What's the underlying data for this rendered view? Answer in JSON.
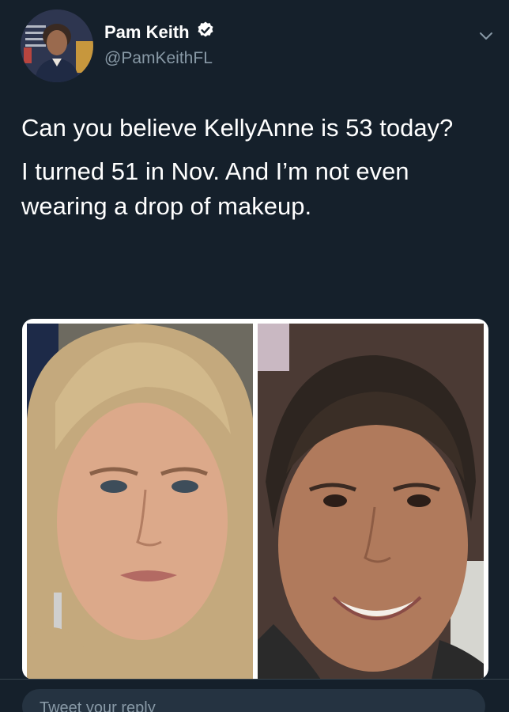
{
  "tweet": {
    "author": {
      "display_name": "Pam Keith",
      "handle": "@PamKeithFL",
      "verified": true
    },
    "paragraphs": [
      "Can you believe KellyAnne is 53 today?",
      "I turned 51 in Nov.  And I’m not even wearing a drop of makeup."
    ],
    "media": {
      "count": 2
    }
  },
  "reply": {
    "placeholder": "Tweet your reply"
  },
  "icons": {
    "verified": "verified-badge-icon",
    "menu": "chevron-down-icon"
  },
  "colors": {
    "background": "#15202b",
    "secondary_text": "#8899a6",
    "accent": "#1da1f2"
  }
}
